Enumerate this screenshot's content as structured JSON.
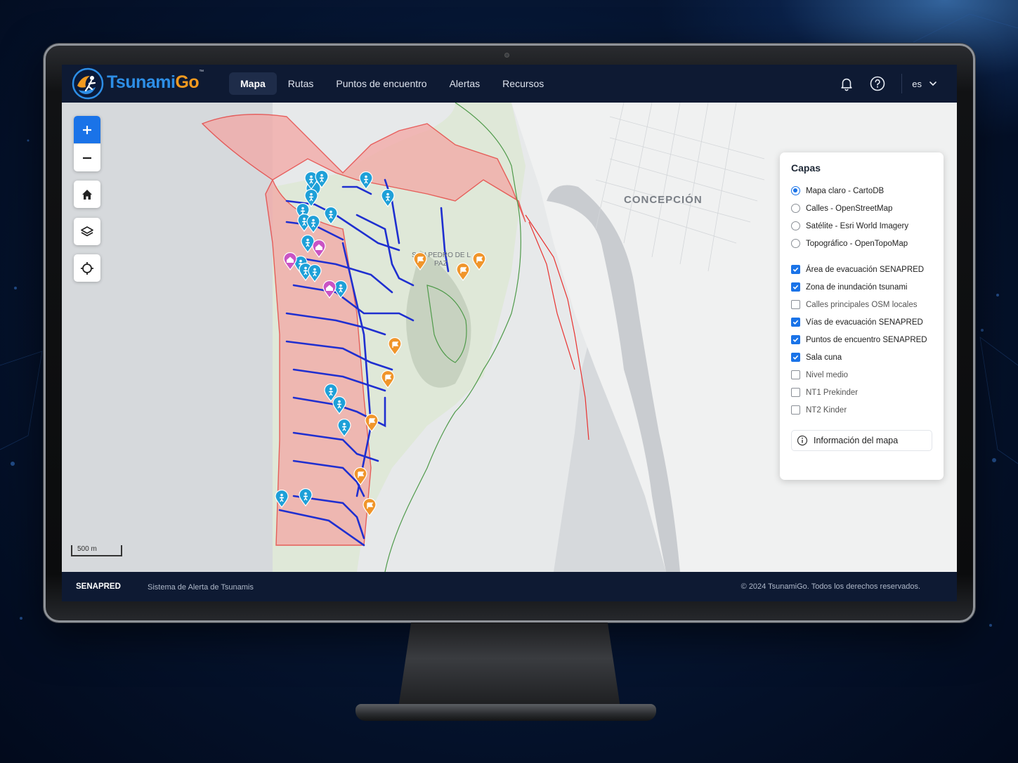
{
  "app": {
    "brand_part1": "Tsunami",
    "brand_part2": "Go",
    "trademark": "™"
  },
  "nav": {
    "items": [
      {
        "label": "Mapa",
        "active": true
      },
      {
        "label": "Rutas",
        "active": false
      },
      {
        "label": "Puntos de encuentro",
        "active": false
      },
      {
        "label": "Alertas",
        "active": false
      },
      {
        "label": "Recursos",
        "active": false
      }
    ]
  },
  "header_right": {
    "notification_icon": "bell-icon",
    "help_icon": "help-icon",
    "language": "es"
  },
  "map": {
    "city_label": "CONCEPCIÓN",
    "district_label_1": "SAN PEDRO DE L",
    "district_label_2": "PAZ",
    "scale_label": "500 m",
    "controls": [
      "zoom-in-icon",
      "zoom-out-icon",
      "home-icon",
      "layers-icon",
      "locate-icon"
    ]
  },
  "layers": {
    "title": "Capas",
    "base_maps": [
      {
        "label": "Mapa claro - CartoDB",
        "selected": true
      },
      {
        "label": "Calles - OpenStreetMap",
        "selected": false
      },
      {
        "label": "Satélite - Esri World Imagery",
        "selected": false
      },
      {
        "label": "Topográfico - OpenTopoMap",
        "selected": false
      }
    ],
    "overlays": [
      {
        "label": "Área de evacuación SENAPRED",
        "checked": true
      },
      {
        "label": "Zona de inundación tsunami",
        "checked": true
      },
      {
        "label": "Calles principales OSM locales",
        "checked": false
      },
      {
        "label": "Vías de evacuación SENAPRED",
        "checked": true
      },
      {
        "label": "Puntos de encuentro SENAPRED",
        "checked": true
      },
      {
        "label": "Sala cuna",
        "checked": true
      },
      {
        "label": "Nivel medio",
        "checked": false
      },
      {
        "label": "NT1 Prekinder",
        "checked": false
      },
      {
        "label": "NT2 Kinder",
        "checked": false
      }
    ],
    "info_button": "Información del mapa"
  },
  "footer": {
    "org": "SENAPRED",
    "system": "Sistema de Alerta de Tsunamis",
    "copyright": "© 2024 TsunamiGo. Todos los derechos reservados."
  },
  "colors": {
    "header_bg": "#0e1a33",
    "brand_blue": "#2d8ee6",
    "brand_orange": "#f39a1f",
    "accent": "#1a73e8",
    "flood_zone": "#e8312f",
    "evac_routes": "#1f2fd0",
    "meeting_point_blue": "#1ea0d8",
    "meeting_point_orange": "#f0952b",
    "nursery_pin": "#c953c4"
  }
}
